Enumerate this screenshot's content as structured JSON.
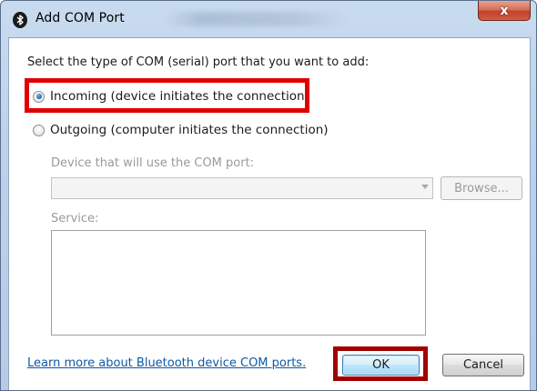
{
  "window": {
    "title": "Add COM Port",
    "close_label": "x"
  },
  "dialog": {
    "prompt": "Select the type of COM (serial) port that you want to add:",
    "options": [
      {
        "label": "Incoming (device initiates the connection)",
        "checked": true
      },
      {
        "label": "Outgoing (computer initiates the connection)",
        "checked": false
      }
    ],
    "device_label": "Device that will use the COM port:",
    "device_value": "",
    "browse_label": "Browse...",
    "service_label": "Service:",
    "service_value": "",
    "learn_more_link": "Learn more about Bluetooth device COM ports.",
    "ok_label": "OK",
    "cancel_label": "Cancel"
  },
  "icons": {
    "app": "bluetooth-icon",
    "dropdown": "chevron-down-icon"
  },
  "colors": {
    "highlight": "#e00000",
    "link": "#0b5aa8",
    "disabled_text": "#9a9a9a"
  }
}
